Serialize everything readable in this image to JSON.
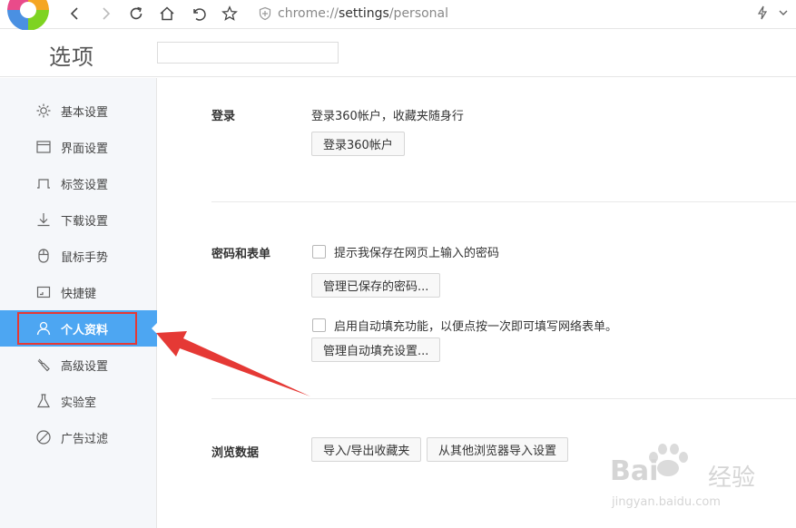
{
  "browser": {
    "url_prefix": "chrome://",
    "url_host": "settings",
    "url_path": "/personal"
  },
  "header": {
    "title": "选项",
    "search_value": ""
  },
  "sidebar": {
    "items": [
      {
        "label": "基本设置",
        "icon": "gear-icon"
      },
      {
        "label": "界面设置",
        "icon": "window-icon"
      },
      {
        "label": "标签设置",
        "icon": "tab-icon"
      },
      {
        "label": "下载设置",
        "icon": "download-icon"
      },
      {
        "label": "鼠标手势",
        "icon": "mouse-icon"
      },
      {
        "label": "快捷键",
        "icon": "keyboard-icon"
      },
      {
        "label": "个人资料",
        "icon": "person-icon",
        "active": true
      },
      {
        "label": "高级设置",
        "icon": "wrench-icon"
      },
      {
        "label": "实验室",
        "icon": "flask-icon"
      },
      {
        "label": "广告过滤",
        "icon": "block-icon"
      }
    ]
  },
  "content": {
    "login": {
      "label": "登录",
      "desc": "登录360帐户，收藏夹随身行",
      "button": "登录360帐户"
    },
    "password": {
      "label": "密码和表单",
      "save_password_checkbox": "提示我保存在网页上输入的密码",
      "manage_passwords_button": "管理已保存的密码...",
      "autofill_checkbox": "启用自动填充功能，以便点按一次即可填写网络表单。",
      "manage_autofill_button": "管理自动填充设置..."
    },
    "browsing": {
      "label": "浏览数据",
      "import_export_button": "导入/导出收藏夹",
      "import_other_button": "从其他浏览器导入设置"
    }
  },
  "watermark": {
    "brand": "Bai",
    "brand_tail": "经验",
    "site": "jingyan.baidu.com"
  },
  "colors": {
    "accent": "#4da6f2",
    "annotation": "#e53935"
  }
}
